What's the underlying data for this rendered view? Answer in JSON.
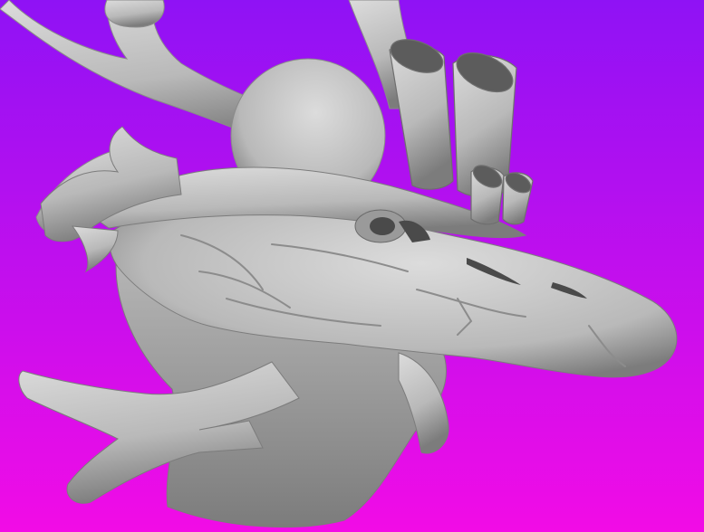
{
  "scene": {
    "subject": "sculpted-creature-head-render",
    "background_top": "#8f12f5",
    "background_bottom": "#f20ce6",
    "material_light": "#dcdcdc",
    "material_mid": "#b9b9b9",
    "material_shadow": "#7c7c7c",
    "cavity_color": "#4a4a4a"
  }
}
